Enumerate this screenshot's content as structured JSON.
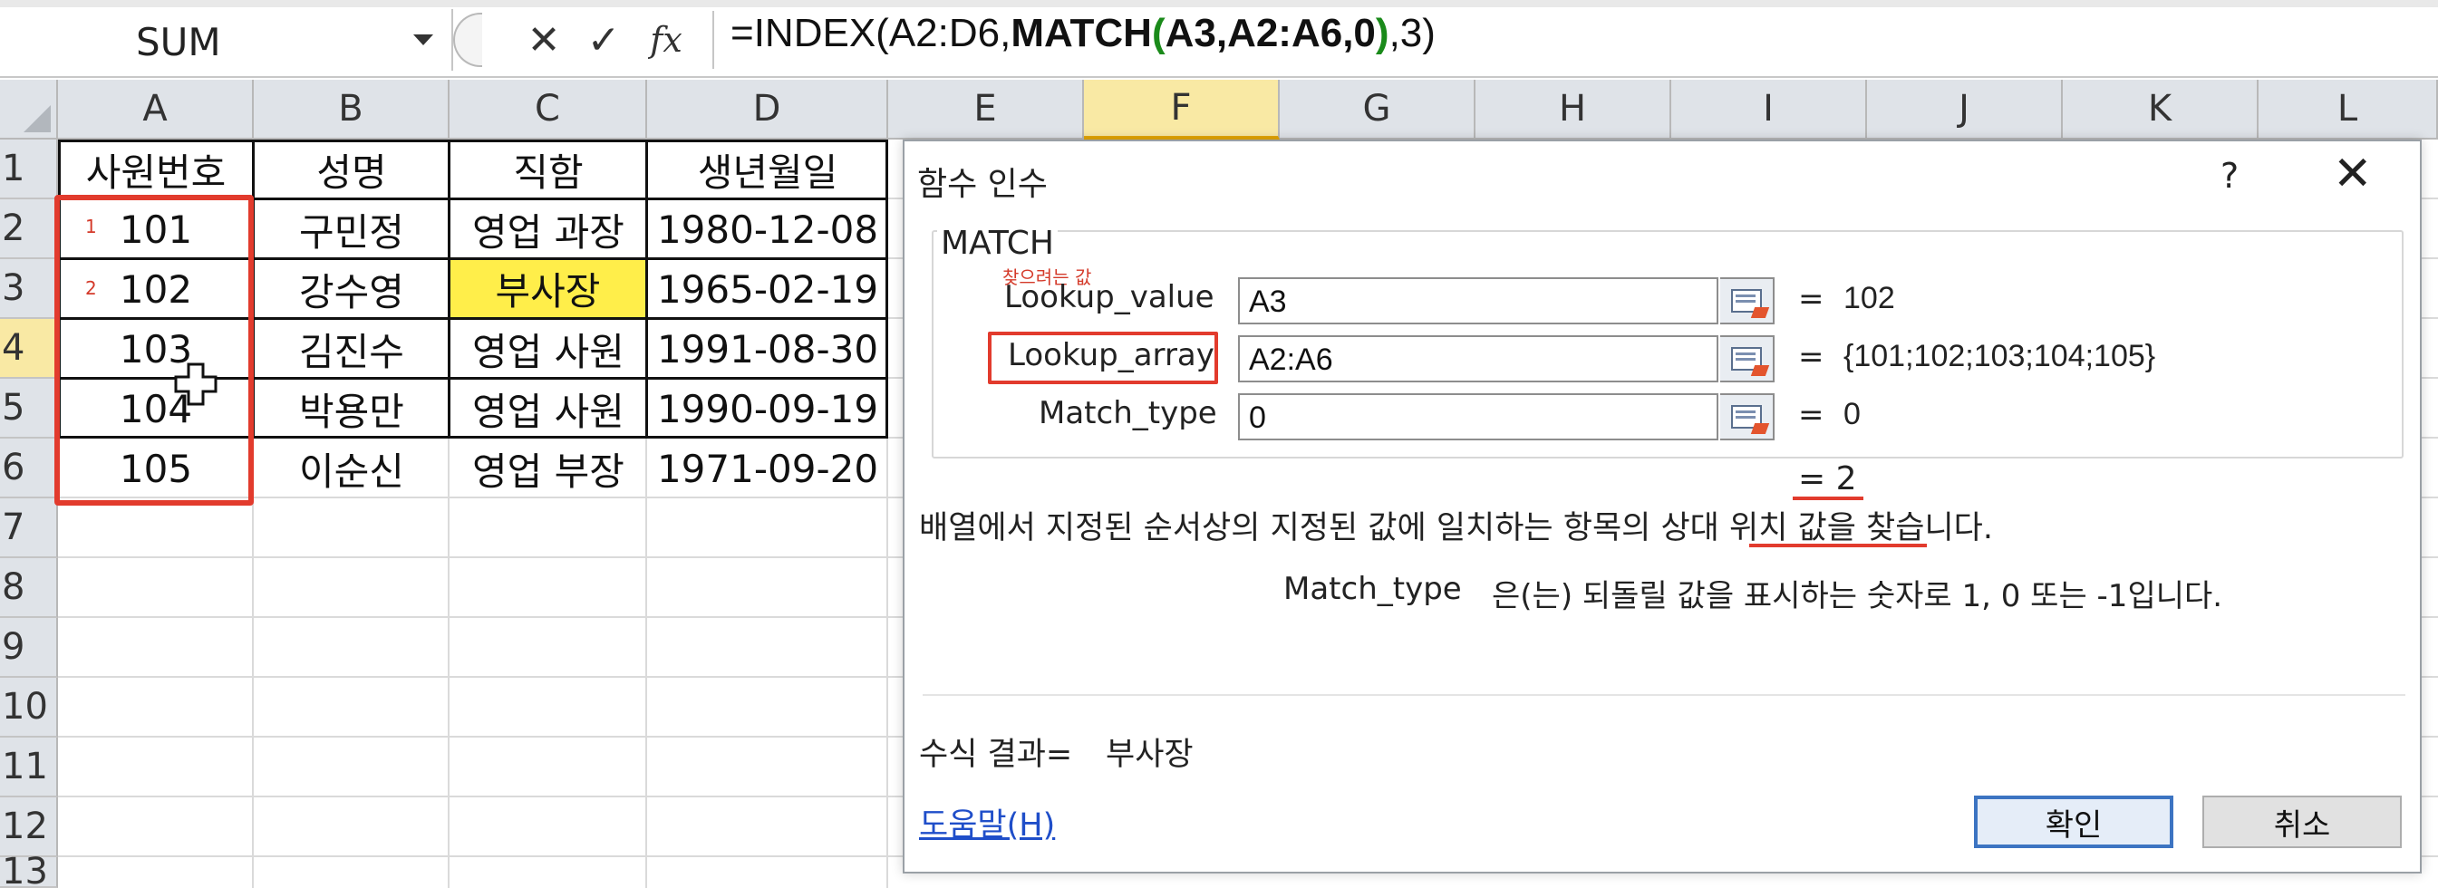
{
  "formula_bar": {
    "name_box": "SUM",
    "cancel_icon": "✕",
    "enter_icon": "✓",
    "fx_label": "fx",
    "formula_parts": [
      "=INDEX(A2:D6,",
      "MATCH",
      "(",
      "A3,A2:A6,0",
      ")",
      ",3)"
    ]
  },
  "columns": [
    "A",
    "B",
    "C",
    "D",
    "E",
    "F",
    "G",
    "H",
    "I",
    "J",
    "K",
    "L"
  ],
  "rows": [
    "1",
    "2",
    "3",
    "4",
    "5",
    "6",
    "7",
    "8",
    "9",
    "10",
    "11",
    "12",
    "13"
  ],
  "active_column": "F",
  "active_row": "4",
  "table": {
    "headers": [
      "사원번호",
      "성명",
      "직함",
      "생년월일"
    ],
    "rows": [
      [
        "101",
        "구민정",
        "영업 과장",
        "1980-12-08"
      ],
      [
        "102",
        "강수영",
        "부사장",
        "1965-02-19"
      ],
      [
        "103",
        "김진수",
        "영업 사원",
        "1991-08-30"
      ],
      [
        "104",
        "박용만",
        "영업 사원",
        "1990-09-19"
      ],
      [
        "105",
        "이순신",
        "영업 부장",
        "1971-09-20"
      ]
    ]
  },
  "annotations": {
    "row_marker_1": "1",
    "row_marker_2": "2",
    "lookup_value_note": "찾으려는 값"
  },
  "dialog": {
    "title": "함수 인수",
    "help_icon": "?",
    "close_icon": "✕",
    "function_name": "MATCH",
    "args": [
      {
        "label": "Lookup_value",
        "value": "A3",
        "result": "102"
      },
      {
        "label": "Lookup_array",
        "value": "A2:A6",
        "result": "{101;102;103;104;105}"
      },
      {
        "label": "Match_type",
        "value": "0",
        "result": "0"
      }
    ],
    "equals": "=",
    "function_result": "=  2",
    "description": "배열에서 지정된 순서상의 지정된 값에 일치하는 항목의 상대 위치 값을 찾습니다.",
    "arg_desc_name": "Match_type",
    "arg_desc_text": "은(는) 되돌릴 값을 표시하는 숫자로 1, 0 또는 -1입니다.",
    "formula_result_label": "수식 결과=",
    "formula_result_value": "부사장",
    "help_link": "도움말(H)",
    "ok_label": "확인",
    "cancel_label": "취소"
  },
  "colors": {
    "highlight_red": "#e23b2d",
    "cell_yellow": "#ffee4a",
    "active_header": "#f9e9a4",
    "link_blue": "#1f4ec9"
  }
}
